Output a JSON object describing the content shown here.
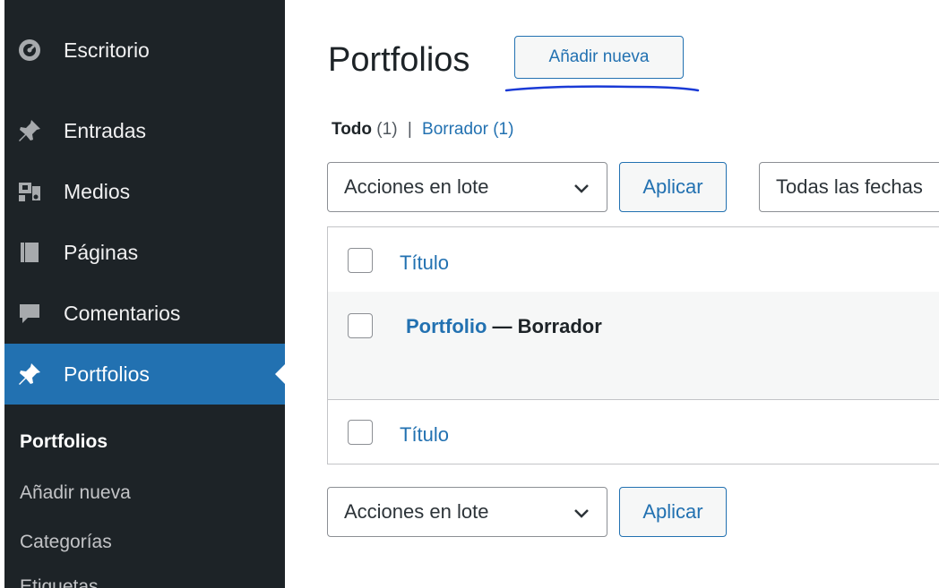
{
  "sidebar": {
    "items": [
      {
        "label": "Escritorio",
        "icon": "dashboard-icon"
      },
      {
        "label": "Entradas",
        "icon": "pin-icon"
      },
      {
        "label": "Medios",
        "icon": "media-icon"
      },
      {
        "label": "Páginas",
        "icon": "pages-icon"
      },
      {
        "label": "Comentarios",
        "icon": "comments-icon"
      },
      {
        "label": "Portfolios",
        "icon": "pin-icon",
        "current": true
      }
    ],
    "submenu": [
      "Portfolios",
      "Añadir nueva",
      "Categorías",
      "Etiquetas"
    ]
  },
  "main": {
    "title": "Portfolios",
    "add_new_label": "Añadir nueva",
    "filters": {
      "all_label": "Todo",
      "all_count": "(1)",
      "separator": "|",
      "draft_label": "Borrador",
      "draft_count": "(1)"
    },
    "bulk_actions_label": "Acciones en lote",
    "apply_label": "Aplicar",
    "dates_filter_label": "Todas las fechas",
    "table": {
      "column_title": "Título",
      "rows": [
        {
          "title": "Portfolio",
          "state": " — Borrador"
        }
      ]
    }
  },
  "colors": {
    "sidebar_bg": "#1d2327",
    "accent": "#2271b1",
    "scribble": "#1a3ad6"
  }
}
